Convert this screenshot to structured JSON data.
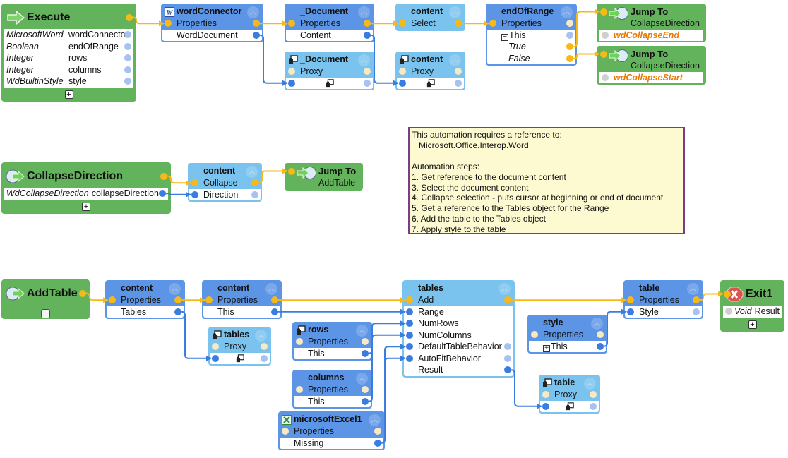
{
  "colors": {
    "exec_wire": "#f7b918",
    "data_wire": "#3a7de0",
    "blue_node": "#5d95e6",
    "light_node": "#79c3ee",
    "green_node": "#63b35c",
    "note_bg": "#fdf9d1",
    "note_border": "#7a3c86"
  },
  "nodes": [
    {
      "id": "execute",
      "kind": "green",
      "icon": "arrow-right-icon",
      "title": "Execute",
      "titlePinR": "exec",
      "body": [
        {
          "type": "MicrosoftWord",
          "text": "wordConnector",
          "R": "faint"
        },
        {
          "type": "Boolean",
          "text": "endOfRange",
          "R": "faint"
        },
        {
          "type": "Integer",
          "text": "rows",
          "R": "faint"
        },
        {
          "type": "Integer",
          "text": "columns",
          "R": "faint"
        },
        {
          "type": "WdBuiltinStyle",
          "text": "style",
          "R": "faint"
        }
      ],
      "footer": "plus"
    },
    {
      "id": "wordConnector",
      "kind": "blue",
      "icon": "word-icon",
      "title": "wordConnector",
      "header": [
        {
          "text": "Properties",
          "L": "exec",
          "R": "exec"
        }
      ],
      "body": [
        {
          "text": "WordDocument",
          "R": "data"
        }
      ]
    },
    {
      "id": "doc1",
      "kind": "blue",
      "title": "_Document",
      "header": [
        {
          "text": "Properties",
          "L": "exec",
          "R": "exec"
        }
      ],
      "body": [
        {
          "text": "Content",
          "R": "data"
        }
      ]
    },
    {
      "id": "contentSelect",
      "kind": "light",
      "title": "content",
      "header": [
        {
          "text": "Select",
          "L": "exec",
          "R": "exec"
        }
      ],
      "body": []
    },
    {
      "id": "endOfRange",
      "kind": "blue",
      "title": "endOfRange",
      "header": [
        {
          "text": "Properties",
          "L": "exec",
          "R": "cream"
        }
      ],
      "body": [
        {
          "text": "This",
          "tree": "minus",
          "R": "faint"
        },
        {
          "text": "True",
          "italic": true,
          "tree": "branch",
          "R": "exec"
        },
        {
          "text": "False",
          "italic": true,
          "tree": "branch",
          "R": "exec"
        }
      ]
    },
    {
      "id": "jump1",
      "kind": "green",
      "jump": true,
      "icon": "jump-to-icon",
      "title": "Jump To",
      "titlePinL": "exec",
      "sub": "CollapseDirection",
      "body": [
        {
          "text": "wdCollapseEnd",
          "orange": true,
          "L": "gray"
        }
      ]
    },
    {
      "id": "jump2",
      "kind": "green",
      "jump": true,
      "icon": "jump-to-icon",
      "title": "Jump To",
      "titlePinL": "exec",
      "sub": "CollapseDirection",
      "body": [
        {
          "text": "wdCollapseStart",
          "orange": true,
          "L": "gray"
        }
      ]
    },
    {
      "id": "docProxy",
      "kind": "light",
      "icon": "proxy-icon",
      "title": "_Document",
      "header": [
        {
          "text": "Proxy",
          "L": "cream",
          "R": "cream"
        }
      ],
      "body": [
        {
          "proxy": true,
          "L": "data",
          "R": "faint"
        }
      ]
    },
    {
      "id": "contentProxy",
      "kind": "light",
      "icon": "proxy-icon",
      "title": "content",
      "header": [
        {
          "text": "Proxy",
          "L": "cream",
          "R": "cream"
        }
      ],
      "body": [
        {
          "proxy": true,
          "L": "data",
          "R": "faint"
        }
      ]
    },
    {
      "id": "collapseDir",
      "kind": "green",
      "icon": "label-icon",
      "title": "CollapseDirection",
      "titlePinR": "exec",
      "body": [
        {
          "type": "WdCollapseDirection",
          "text": "collapseDirection",
          "R": "data"
        }
      ],
      "footer": "plus"
    },
    {
      "id": "contentCollapse",
      "kind": "light",
      "title": "content",
      "header": [
        {
          "text": "Collapse",
          "L": "exec",
          "R": "exec"
        }
      ],
      "body": [
        {
          "text": "Direction",
          "L": "data",
          "R": "faint"
        }
      ]
    },
    {
      "id": "jumpAdd",
      "kind": "green",
      "jump": true,
      "icon": "jump-to-icon",
      "title": "Jump To",
      "titlePinL": "exec",
      "sub": "AddTable",
      "body": []
    },
    {
      "id": "addTable",
      "kind": "green",
      "icon": "label-icon",
      "title": "AddTable",
      "titlePinR": "exec",
      "body": [],
      "footer": "checkbox"
    },
    {
      "id": "contentTables",
      "kind": "blue",
      "title": "content",
      "header": [
        {
          "text": "Properties",
          "L": "exec",
          "R": "exec"
        }
      ],
      "body": [
        {
          "text": "Tables",
          "R": "data"
        }
      ]
    },
    {
      "id": "contentThis",
      "kind": "blue",
      "title": "content",
      "header": [
        {
          "text": "Properties",
          "L": "exec",
          "R": "exec"
        }
      ],
      "body": [
        {
          "text": "This",
          "R": "data"
        }
      ]
    },
    {
      "id": "tablesProxy",
      "kind": "light",
      "icon": "proxy-icon",
      "title": "tables",
      "header": [
        {
          "text": "Proxy",
          "L": "cream",
          "R": "cream"
        }
      ],
      "body": [
        {
          "proxy": true,
          "L": "data",
          "R": "faint"
        }
      ]
    },
    {
      "id": "rows",
      "kind": "blue",
      "icon": "proxy-icon",
      "title": "rows",
      "header": [
        {
          "text": "Properties",
          "L": "cream",
          "R": "cream"
        }
      ],
      "body": [
        {
          "text": "This",
          "R": "data"
        }
      ]
    },
    {
      "id": "columns",
      "kind": "blue",
      "title": "columns",
      "header": [
        {
          "text": "Properties",
          "L": "cream",
          "R": "cream"
        }
      ],
      "body": [
        {
          "text": "This",
          "R": "data"
        }
      ]
    },
    {
      "id": "excel",
      "kind": "blue",
      "icon": "excel-icon",
      "title": "microsoftExcel1",
      "header": [
        {
          "text": "Properties",
          "L": "cream",
          "R": "cream"
        }
      ],
      "body": [
        {
          "text": "Missing",
          "R": "data"
        }
      ]
    },
    {
      "id": "tables",
      "kind": "light",
      "title": "tables",
      "header": [
        {
          "text": "Add",
          "L": "exec",
          "R": "exec"
        }
      ],
      "body": [
        {
          "text": "Range",
          "L": "data"
        },
        {
          "text": "NumRows",
          "L": "data"
        },
        {
          "text": "NumColumns",
          "L": "data"
        },
        {
          "text": "DefaultTableBehavior",
          "L": "data",
          "R": "faint"
        },
        {
          "text": "AutoFitBehavior",
          "L": "data",
          "R": "faint"
        },
        {
          "text": "Result",
          "R": "data"
        }
      ]
    },
    {
      "id": "style",
      "kind": "blue",
      "title": "style",
      "header": [
        {
          "text": "Properties",
          "L": "cream",
          "R": "cream"
        }
      ],
      "body": [
        {
          "text": "This",
          "tree": "plus",
          "R": "data"
        }
      ]
    },
    {
      "id": "tableProxy",
      "kind": "light",
      "icon": "proxy-icon",
      "title": "table",
      "header": [
        {
          "text": "Proxy",
          "L": "cream",
          "R": "cream"
        }
      ],
      "body": [
        {
          "proxy": true,
          "L": "data",
          "R": "faint"
        }
      ]
    },
    {
      "id": "tableStyle",
      "kind": "blue",
      "title": "table",
      "header": [
        {
          "text": "Properties",
          "L": "exec",
          "R": "exec"
        }
      ],
      "body": [
        {
          "text": "Style",
          "L": "data",
          "R": "faint"
        }
      ]
    },
    {
      "id": "exit1",
      "kind": "green",
      "icon": "exit-icon",
      "title": "Exit1",
      "titlePinL": "exec",
      "body": [
        {
          "type": "Void",
          "text": "Result",
          "L": "gray"
        }
      ],
      "footer": "plus"
    }
  ],
  "edges": [
    [
      "execute.t.R",
      "wordConnector.0.L"
    ],
    [
      "wordConnector.0.R",
      "doc1.0.L"
    ],
    [
      "doc1.0.R",
      "contentSelect.0.L"
    ],
    [
      "contentSelect.0.R",
      "endOfRange.0.L"
    ],
    [
      "endOfRange.2.R",
      "jump1.t.L"
    ],
    [
      "endOfRange.3.R",
      "jump2.t.L"
    ],
    [
      "wordConnector.1.R",
      "docProxy.1.L"
    ],
    [
      "doc1.1.R",
      "contentProxy.1.L"
    ],
    [
      "collapseDir.t.R",
      "contentCollapse.0.L"
    ],
    [
      "collapseDir.0.R",
      "contentCollapse.1.L"
    ],
    [
      "contentCollapse.0.R",
      "jumpAdd.t.L"
    ],
    [
      "addTable.t.R",
      "contentTables.0.L"
    ],
    [
      "contentTables.0.R",
      "contentThis.0.L"
    ],
    [
      "contentTables.1.R",
      "tablesProxy.1.L"
    ],
    [
      "contentThis.0.R",
      "tables.0.L"
    ],
    [
      "contentThis.1.R",
      "tables.1.L"
    ],
    [
      "rows.1.R",
      "tables.2.L"
    ],
    [
      "columns.1.R",
      "tables.3.L"
    ],
    [
      "excel.1.R",
      "tables.4.L"
    ],
    [
      "excel.1.R",
      "tables.5.L"
    ],
    [
      "tables.0.R",
      "tableStyle.0.L"
    ],
    [
      "tables.6.R",
      "tableProxy.1.L"
    ],
    [
      "style.1.R",
      "tableStyle.1.L"
    ],
    [
      "tableStyle.0.R",
      "exit1.t.L"
    ]
  ],
  "note": {
    "lines": [
      "This automation requires a reference to:",
      "   Microsoft.Office.Interop.Word",
      "",
      "Automation steps:",
      "1. Get reference to the document content",
      "3. Select the document content",
      "4. Collapse selection - puts cursor at beginning or end of document",
      "5. Get a reference to the Tables object for the Range",
      "6. Add the table to the Tables object",
      "7. Apply style to the table"
    ]
  }
}
